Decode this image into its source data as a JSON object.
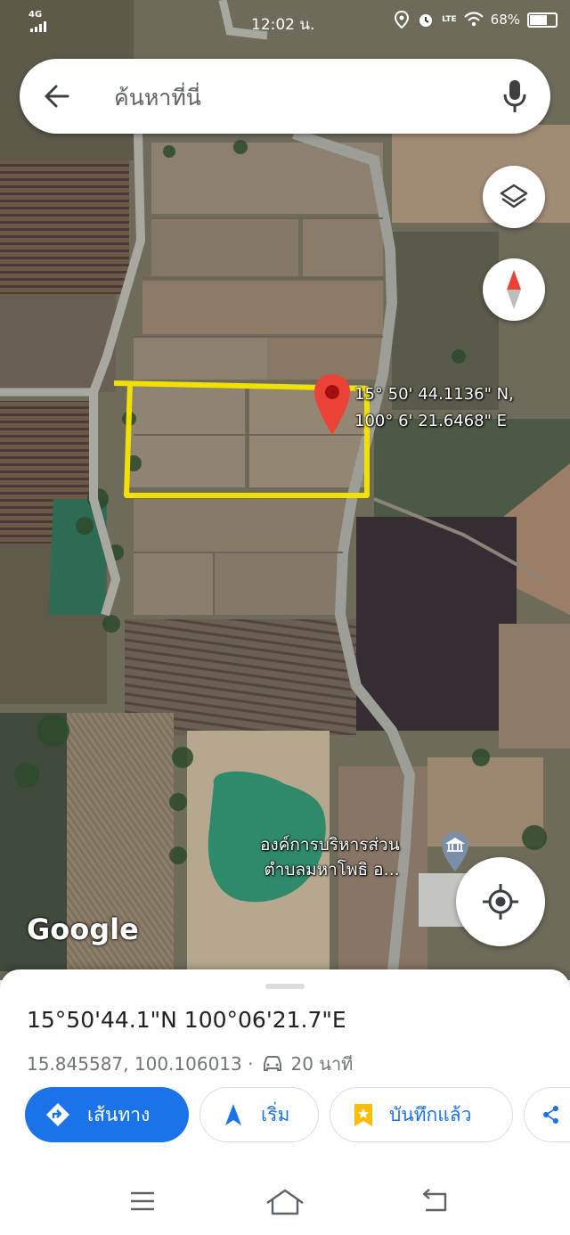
{
  "status_bar": {
    "network": "4G",
    "time": "12:02 น.",
    "volte": "LTE",
    "battery": "68%",
    "battery_level": 0.68
  },
  "search": {
    "placeholder": "ค้นหาที่นี่"
  },
  "map": {
    "pin_label_line1": "15° 50' 44.1136\" N,",
    "pin_label_line2": "100° 6' 21.6468\" E",
    "poi_line1": "องค์การบริหารส่วน",
    "poi_line2": "ตำบลมหาโพธิ อ...",
    "watermark": "Google",
    "pin_color": "#ea4335",
    "highlight_color": "#f2e000"
  },
  "place": {
    "title": "15°50'44.1\"N 100°06'21.7\"E",
    "decimal_coords": "15.845587, 100.106013 ·",
    "drive_time": "20 นาที"
  },
  "actions": {
    "directions": "เส้นทาง",
    "start": "เริ่ม",
    "saved": "บันทึกแล้ว"
  },
  "colors": {
    "accent": "#1a73e8",
    "saved_icon": "#fbbc04"
  }
}
